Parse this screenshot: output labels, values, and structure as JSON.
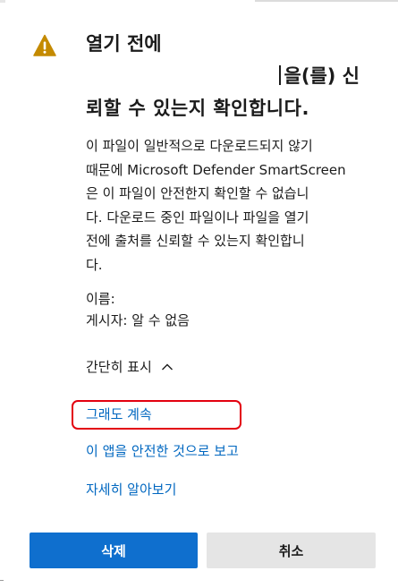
{
  "dialog": {
    "title_line1": "열기 전에",
    "title_line2": "을(를) 신",
    "title_line3": "뢰할 수 있는지 확인합니다.",
    "body_lines": [
      "이 파일이 일반적으로 다운로드되지 않기",
      "때문에 Microsoft Defender SmartScreen",
      "은 이 파일이 안전한지 확인할 수 없습니",
      "다. 다운로드 중인 파일이나 파일을 열기",
      "전에 출처를 신뢰할 수 있는지 확인합니",
      "다."
    ],
    "name_label": "이름:",
    "publisher_label": "게시자: 알 수 없음",
    "toggle_label": "간단히 표시",
    "links": {
      "continue": "그래도 계속",
      "report_safe": "이 앱을 안전한 것으로 보고",
      "learn_more": "자세히 알아보기"
    },
    "buttons": {
      "delete": "삭제",
      "cancel": "취소"
    },
    "colors": {
      "warning_icon": "#c48a00",
      "link": "#0067c0",
      "primary_button": "#0f6fce",
      "secondary_button": "#e5e5e5",
      "highlight": "#e3000f"
    },
    "icons": {
      "warning": "warning-triangle-icon",
      "toggle": "chevron-up-icon"
    }
  }
}
